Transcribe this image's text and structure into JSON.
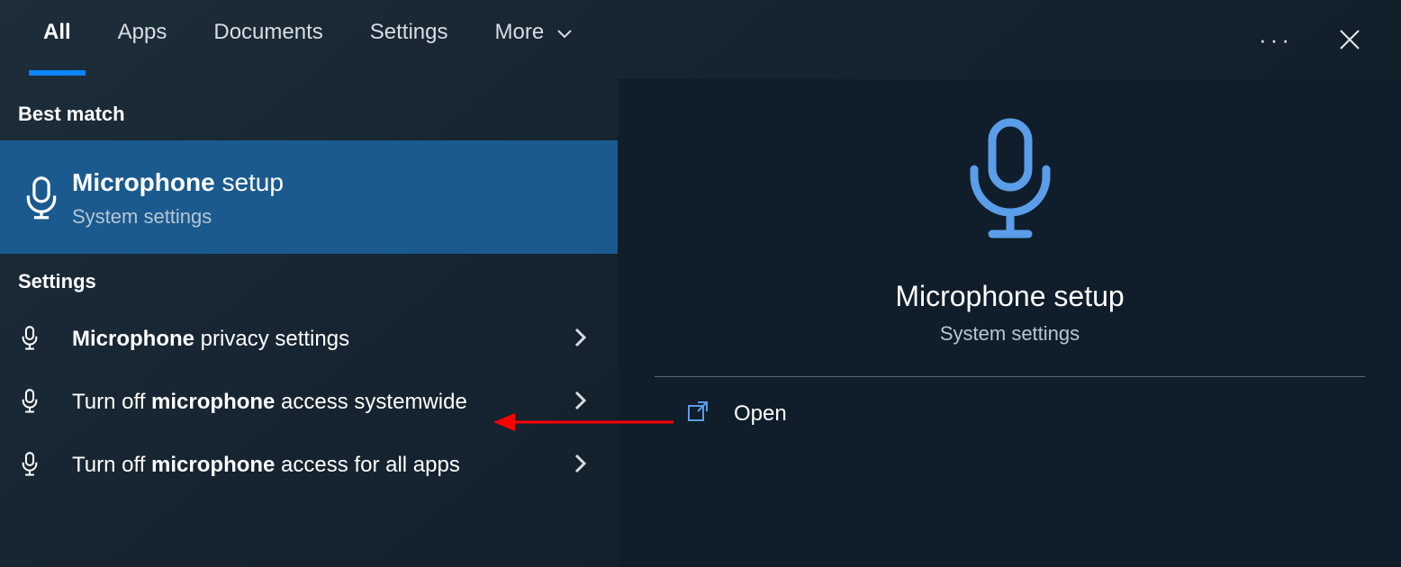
{
  "tabs": {
    "all": "All",
    "apps": "Apps",
    "documents": "Documents",
    "settings": "Settings",
    "more": "More"
  },
  "sections": {
    "best_match": "Best match",
    "settings": "Settings"
  },
  "best_match": {
    "title_bold": "Microphone",
    "title_rest": " setup",
    "subtitle": "System settings"
  },
  "settings_results": [
    {
      "title_bold": "Microphone",
      "title_rest": " privacy settings"
    },
    {
      "title_pre": "Turn off ",
      "title_bold": "microphone",
      "title_rest": " access systemwide"
    },
    {
      "title_pre": "Turn off ",
      "title_bold": "microphone",
      "title_rest": " access for all apps"
    }
  ],
  "detail": {
    "title": "Microphone setup",
    "subtitle": "System settings",
    "open": "Open"
  },
  "icons": {
    "mic": "microphone-icon",
    "open": "open-icon",
    "close": "close-icon",
    "more": "more-icon",
    "chev_down": "chevron-down-icon",
    "chev_right": "chevron-right-icon"
  }
}
